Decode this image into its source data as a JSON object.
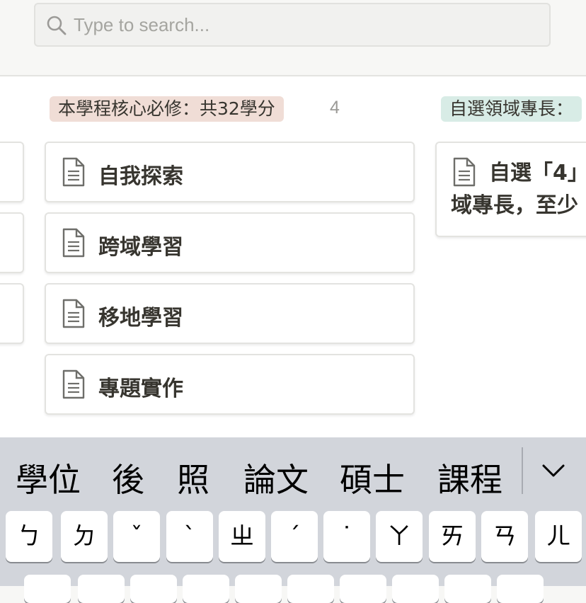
{
  "search": {
    "placeholder": "Type to search..."
  },
  "groups": [
    {
      "label": "本學程核心必修：共32學分",
      "count": "4",
      "color": "#f0ddd6"
    },
    {
      "label": "自選領域專長：",
      "color": "#d8ece6"
    }
  ],
  "cards": [
    {
      "title": "自我探索"
    },
    {
      "title": "跨域學習"
    },
    {
      "title": "移地學習"
    },
    {
      "title": "專題實作"
    }
  ],
  "right_card": {
    "line1": "自選「4」",
    "line2": "域專長，至少"
  },
  "keyboard": {
    "candidates": [
      "學位",
      "後",
      "照",
      "論文",
      "碩士",
      "課程"
    ],
    "keys_row1": [
      "ㄅ",
      "ㄉ",
      "ˇ",
      "ˋ",
      "ㄓ",
      "ˊ",
      "˙",
      "ㄚ",
      "ㄞ",
      "ㄢ",
      "ㄦ"
    ]
  },
  "icons": {
    "search": "search-icon",
    "document": "document-icon",
    "expand": "chevron-down-icon"
  }
}
